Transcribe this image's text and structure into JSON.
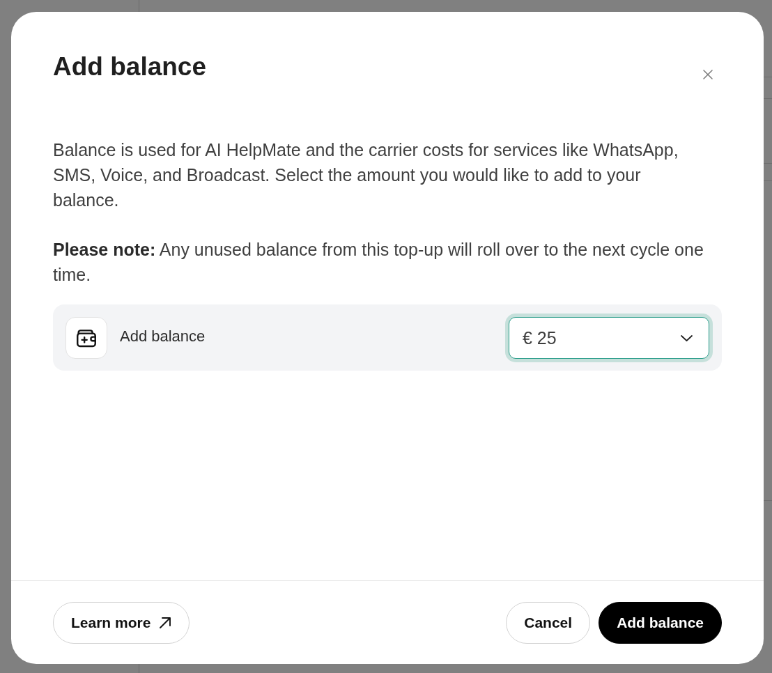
{
  "dialog": {
    "title": "Add balance",
    "paragraphs": [
      "Balance is used for AI HelpMate and the carrier costs for services like WhatsApp, SMS, Voice, and Broadcast. Select the amount you would like to add to your balance.",
      "**Please note:** Any unused balance from this top-up will roll over to the next cycle one time."
    ],
    "balance_row": {
      "label": "Add balance",
      "amount": {
        "value": "€ 25",
        "focused": true
      }
    },
    "footer_buttons": [
      {
        "label": "Learn more",
        "kind": "external-link"
      },
      {
        "label": "Cancel",
        "kind": "secondary"
      },
      {
        "label": "Add balance",
        "kind": "primary"
      }
    ]
  }
}
